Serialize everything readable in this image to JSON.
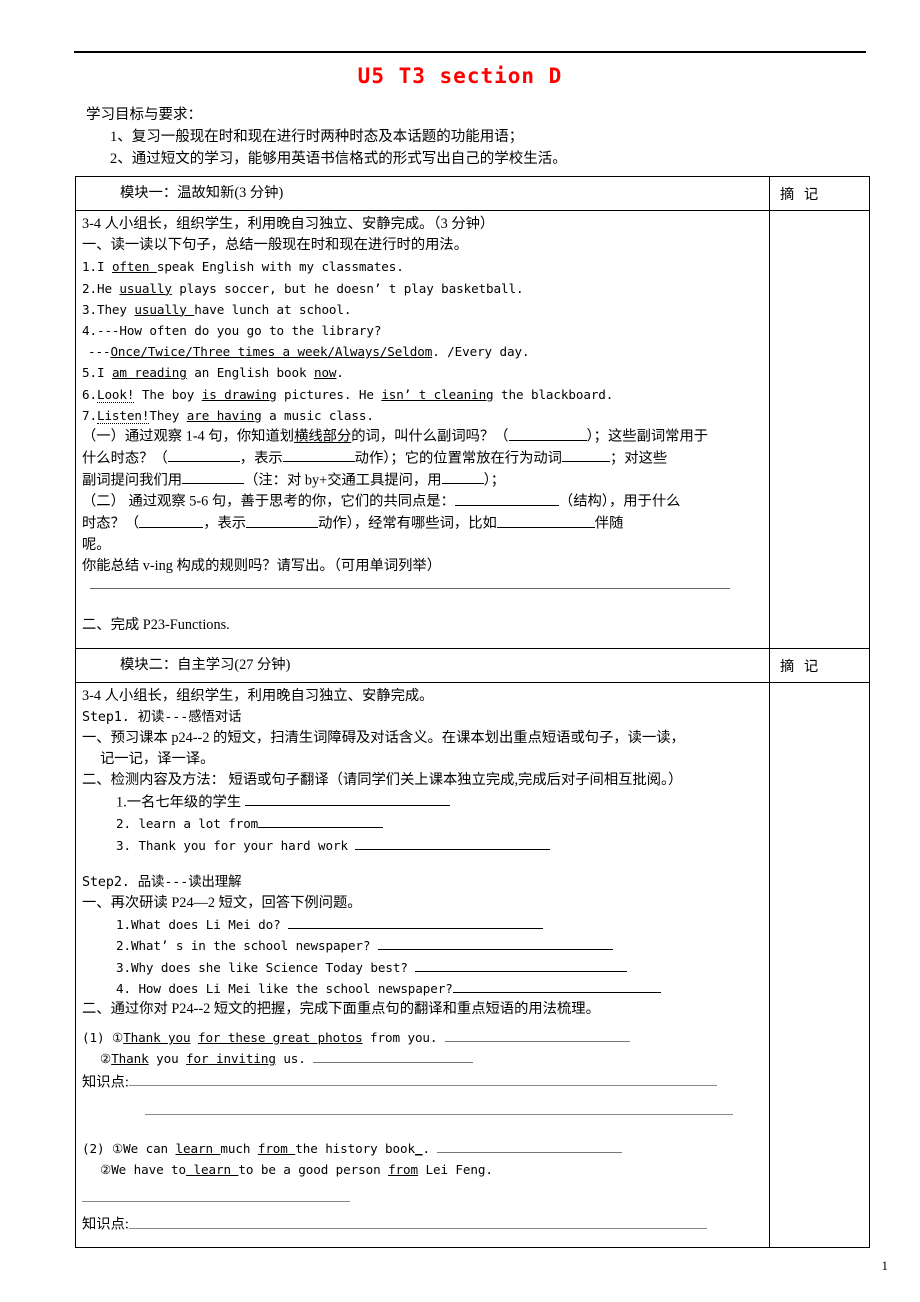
{
  "document": {
    "title": "U5 T3 section D",
    "title_color": "#ff0000",
    "page_number": "1"
  },
  "objectives": {
    "heading": "学习目标与要求：",
    "items": [
      "1、复习一般现在时和现在进行时两种时态及本话题的功能用语；",
      "2、通过短文的学习，能够用英语书信格式的形式写出自己的学校生活。"
    ]
  },
  "table": {
    "notes_column_header": "摘 记",
    "module1": {
      "bar_label": "模块一：温故知新(3 分钟)",
      "intro": "3-4 人小组长，组织学生，利用晚自习独立、安静完成。（3 分钟）",
      "task1": "一、读一读以下句子，总结一般现在时和现在进行时的用法。",
      "sentences": [
        {
          "num": "1.",
          "pre": "I ",
          "u1": "often ",
          "post": "speak English with my classmates."
        },
        {
          "num": "2.",
          "pre": "He ",
          "u1": "usually",
          "post": " plays soccer, but he doesn’ t play basketball."
        },
        {
          "num": "3.",
          "pre": "They ",
          "u1": "usually ",
          "post": "have lunch at school."
        },
        {
          "num": "4.",
          "pre": "---How often ",
          "u1": "",
          "post": "do you go to the library?"
        },
        {
          "num": "",
          "pre": "---",
          "u1": "Once/Twice/Three times a week/Always/Seldom",
          "post": ". /Every day."
        },
        {
          "num": "5.",
          "pre": "I ",
          "u1": "am reading",
          "post": " an English book ",
          "u2": "now",
          "post2": "."
        },
        {
          "num": "6.",
          "pre": "",
          "u1": "Look!",
          "post": " The boy ",
          "u2": "is drawing",
          "post2": " pictures. He ",
          "u3": "isn’ t cleaning",
          "post3": " the blackboard."
        },
        {
          "num": "7.",
          "pre": "",
          "u1": "Listen!",
          "post": "They ",
          "u2": "are having",
          "post2": " a music class."
        }
      ],
      "q1_line1_a": "（一）通过观察 1-4 句，你知道划",
      "q1_line1_u": "横线部分",
      "q1_line1_b": "的词，叫什么副词吗？（",
      "q1_line1_c": "）；这些副词常用于",
      "q1_line2_a": "什么时态？（",
      "q1_line2_b": "，表示",
      "q1_line2_c": "动作）；它的位置常放在行为动词",
      "q1_line2_d": "；对这些",
      "q1_line3_a": "副词提问我们用",
      "q1_line3_b": "（注：对 by+交通工具提问，用",
      "q1_line3_c": "）；",
      "q2_line1_a": "（二） 通过观察 5-6 句，善于思考的你，它们的共同点是：",
      "q2_line1_b": "（结构），用于什么",
      "q2_line2_a": "时态？（",
      "q2_line2_b": "，表示",
      "q2_line2_c": "动作），经常有哪些词，比如",
      "q2_line2_d": "伴随",
      "q2_line3": "呢。",
      "q3": "你能总结 v-ing 构成的规则吗？请写出。（可用单词列举）",
      "task2": "二、完成 P23-Functions."
    },
    "module2": {
      "bar_label": "模块二：自主学习(27 分钟)",
      "intro": "3-4 人小组长，组织学生，利用晚自习独立、安静完成。",
      "step1_title": "Step1. 初读---感悟对话",
      "step1_task1_l1": "一、预习课本 p24--2 的短文，扫清生词障碍及对话含义。在课本划出重点短语或句子，读一读，",
      "step1_task1_l2": "记一记，译一译。",
      "step1_task2": "二、检测内容及方法： 短语或句子翻译（请同学们关上课本独立完成,完成后对子间相互批阅。）",
      "translate_items": [
        {
          "num": "1.",
          "text": "一名七年级的学生 ",
          "type": "cn",
          "blank_width": 205
        },
        {
          "num": "2.",
          "text": " learn a lot from",
          "type": "en",
          "blank_width": 125
        },
        {
          "num": "3.",
          "text": " Thank you for your hard work ",
          "type": "en",
          "blank_width": 195
        }
      ],
      "step2_title": "Step2. 品读---读出理解",
      "step2_task1": "一、再次研读 P24—2 短文，回答下例问题。",
      "questions": [
        {
          "num": "1.",
          "text": "What does Li Mei do? ",
          "blank_width": 255
        },
        {
          "num": "2.",
          "text": "What’ s in the school newspaper? ",
          "blank_width": 235
        },
        {
          "num": "3.",
          "text": "Why does she like Science Today best? ",
          "blank_width": 212
        },
        {
          "num": "4.",
          "text": " How does Li Mei like the school newspaper?",
          "blank_width": 208
        }
      ],
      "step2_task2": "二、通过你对 P24--2 短文的把握，完成下面重点句的翻译和重点短语的用法梳理。",
      "group1": {
        "label": "(1)",
        "item1_num": "①",
        "item1_u1": "Thank you",
        "item1_mid": " ",
        "item1_u2": "for these great photos",
        "item1_post": " from you. ",
        "item1_blank": 185,
        "item2_num": "②",
        "item2_u1": "Thank",
        "item2_mid": " you ",
        "item2_u2": "for inviting",
        "item2_post": " us. ",
        "item2_blank": 160,
        "note_label": "知识点:"
      },
      "group2": {
        "label": "(2)",
        "item1_num": "①",
        "item1_pre": "We can ",
        "item1_u1": "learn ",
        "item1_mid": "much ",
        "item1_u2": "from ",
        "item1_post": "the history book",
        "item1_u3": "_",
        "item1_end": ". ",
        "item1_blank": 185,
        "item2_num": "②",
        "item2_pre": "We have to",
        "item2_u1": " learn ",
        "item2_mid": "to be a good person ",
        "item2_u2": "from",
        "item2_post": " Lei Feng.",
        "note_label": "知识点:"
      }
    }
  }
}
